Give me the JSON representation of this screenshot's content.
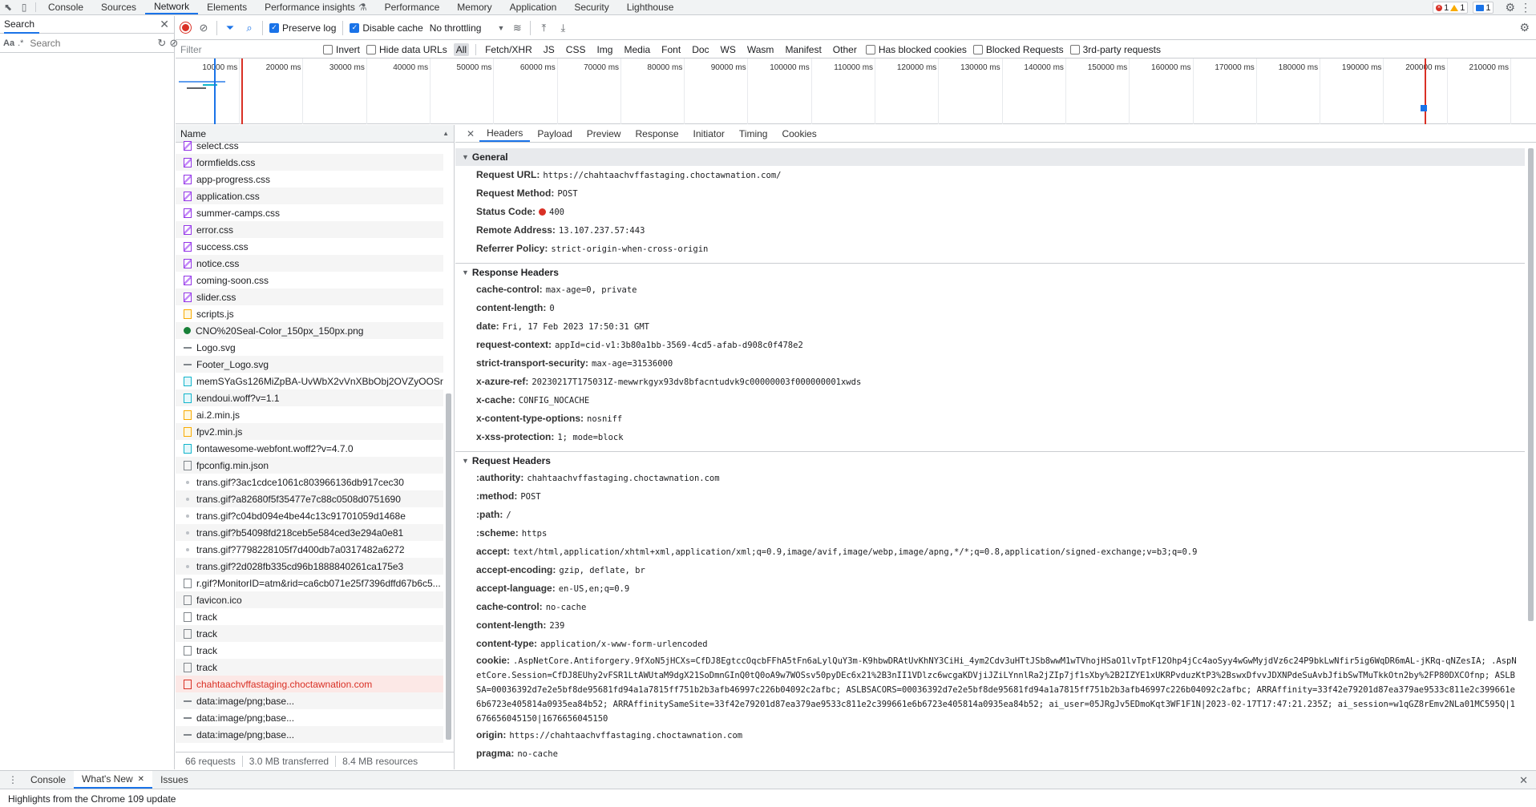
{
  "topbar": {
    "tabs": [
      "Console",
      "Sources",
      "Network",
      "Elements",
      "Performance insights",
      "Performance",
      "Memory",
      "Application",
      "Security",
      "Lighthouse"
    ],
    "active_tab": "Network",
    "errors": "1",
    "warnings": "1",
    "messages": "1"
  },
  "search_pane": {
    "title": "Search",
    "case_label": "Aa",
    "regex_label": ".*",
    "placeholder": "Search"
  },
  "toolbar": {
    "preserve_log": "Preserve log",
    "disable_cache": "Disable cache",
    "throttling": "No throttling"
  },
  "filter": {
    "placeholder": "Filter",
    "invert": "Invert",
    "hide_data_urls": "Hide data URLs",
    "types": [
      "All",
      "Fetch/XHR",
      "JS",
      "CSS",
      "Img",
      "Media",
      "Font",
      "Doc",
      "WS",
      "Wasm",
      "Manifest",
      "Other"
    ],
    "has_blocked_cookies": "Has blocked cookies",
    "blocked_requests": "Blocked Requests",
    "third_party": "3rd-party requests"
  },
  "overview": {
    "ticks": [
      "10000 ms",
      "20000 ms",
      "30000 ms",
      "40000 ms",
      "50000 ms",
      "60000 ms",
      "70000 ms",
      "80000 ms",
      "90000 ms",
      "100000 ms",
      "110000 ms",
      "120000 ms",
      "130000 ms",
      "140000 ms",
      "150000 ms",
      "160000 ms",
      "170000 ms",
      "180000 ms",
      "190000 ms",
      "200000 ms",
      "210000 ms"
    ]
  },
  "request_list": {
    "column": "Name",
    "rows": [
      {
        "name": "select.css",
        "type": "css"
      },
      {
        "name": "formfields.css",
        "type": "css"
      },
      {
        "name": "app-progress.css",
        "type": "css"
      },
      {
        "name": "application.css",
        "type": "css"
      },
      {
        "name": "summer-camps.css",
        "type": "css"
      },
      {
        "name": "error.css",
        "type": "css"
      },
      {
        "name": "success.css",
        "type": "css"
      },
      {
        "name": "notice.css",
        "type": "css"
      },
      {
        "name": "coming-soon.css",
        "type": "css"
      },
      {
        "name": "slider.css",
        "type": "css"
      },
      {
        "name": "scripts.js",
        "type": "js"
      },
      {
        "name": "CNO%20Seal-Color_150px_150px.png",
        "type": "img"
      },
      {
        "name": "Logo.svg",
        "type": "svg"
      },
      {
        "name": "Footer_Logo.svg",
        "type": "svg"
      },
      {
        "name": "memSYaGs126MiZpBA-UvWbX2vVnXBbObj2OVZyOOSr4...",
        "type": "font"
      },
      {
        "name": "kendoui.woff?v=1.1",
        "type": "font"
      },
      {
        "name": "ai.2.min.js",
        "type": "js"
      },
      {
        "name": "fpv2.min.js",
        "type": "js"
      },
      {
        "name": "fontawesome-webfont.woff2?v=4.7.0",
        "type": "font"
      },
      {
        "name": "fpconfig.min.json",
        "type": "doc"
      },
      {
        "name": "trans.gif?3ac1cdce1061c803966136db917cec30",
        "type": "gif"
      },
      {
        "name": "trans.gif?a82680f5f35477e7c88c0508d0751690",
        "type": "gif"
      },
      {
        "name": "trans.gif?c04bd094e4be44c13c91701059d1468e",
        "type": "gif"
      },
      {
        "name": "trans.gif?b54098fd218ceb5e584ced3e294a0e81",
        "type": "gif"
      },
      {
        "name": "trans.gif?7798228105f7d400db7a0317482a6272",
        "type": "gif"
      },
      {
        "name": "trans.gif?2d028fb335cd96b1888840261ca175e3",
        "type": "gif"
      },
      {
        "name": "r.gif?MonitorID=atm&rid=ca6cb071e25f7396dffd67b6c5...",
        "type": "doc"
      },
      {
        "name": "favicon.ico",
        "type": "doc"
      },
      {
        "name": "track",
        "type": "doc"
      },
      {
        "name": "track",
        "type": "doc"
      },
      {
        "name": "track",
        "type": "doc"
      },
      {
        "name": "track",
        "type": "doc"
      },
      {
        "name": "chahtaachvffastaging.choctawnation.com",
        "type": "errdoc",
        "error": true
      },
      {
        "name": "data:image/png;base...",
        "type": "svg"
      },
      {
        "name": "data:image/png;base...",
        "type": "svg"
      },
      {
        "name": "data:image/png;base...",
        "type": "svg"
      }
    ],
    "status": {
      "requests": "66 requests",
      "transferred": "3.0 MB transferred",
      "resources": "8.4 MB resources"
    }
  },
  "details": {
    "tabs": [
      "Headers",
      "Payload",
      "Preview",
      "Response",
      "Initiator",
      "Timing",
      "Cookies"
    ],
    "active_tab": "Headers",
    "general": {
      "title": "General",
      "items": [
        {
          "k": "Request URL:",
          "v": "https://chahtaachvffastaging.choctawnation.com/"
        },
        {
          "k": "Request Method:",
          "v": "POST"
        },
        {
          "k": "Status Code:",
          "v": "400",
          "dot": true
        },
        {
          "k": "Remote Address:",
          "v": "13.107.237.57:443"
        },
        {
          "k": "Referrer Policy:",
          "v": "strict-origin-when-cross-origin"
        }
      ]
    },
    "response_headers": {
      "title": "Response Headers",
      "items": [
        {
          "k": "cache-control:",
          "v": "max-age=0, private"
        },
        {
          "k": "content-length:",
          "v": "0"
        },
        {
          "k": "date:",
          "v": "Fri, 17 Feb 2023 17:50:31 GMT"
        },
        {
          "k": "request-context:",
          "v": "appId=cid-v1:3b80a1bb-3569-4cd5-afab-d908c0f478e2"
        },
        {
          "k": "strict-transport-security:",
          "v": "max-age=31536000"
        },
        {
          "k": "x-azure-ref:",
          "v": "20230217T175031Z-mewwrkgyx93dv8bfacntudvk9c00000003f000000001xwds"
        },
        {
          "k": "x-cache:",
          "v": "CONFIG_NOCACHE"
        },
        {
          "k": "x-content-type-options:",
          "v": "nosniff"
        },
        {
          "k": "x-xss-protection:",
          "v": "1; mode=block"
        }
      ]
    },
    "request_headers": {
      "title": "Request Headers",
      "items": [
        {
          "k": ":authority:",
          "v": "chahtaachvffastaging.choctawnation.com"
        },
        {
          "k": ":method:",
          "v": "POST"
        },
        {
          "k": ":path:",
          "v": "/"
        },
        {
          "k": ":scheme:",
          "v": "https"
        },
        {
          "k": "accept:",
          "v": "text/html,application/xhtml+xml,application/xml;q=0.9,image/avif,image/webp,image/apng,*/*;q=0.8,application/signed-exchange;v=b3;q=0.9"
        },
        {
          "k": "accept-encoding:",
          "v": "gzip, deflate, br"
        },
        {
          "k": "accept-language:",
          "v": "en-US,en;q=0.9"
        },
        {
          "k": "cache-control:",
          "v": "no-cache"
        },
        {
          "k": "content-length:",
          "v": "239"
        },
        {
          "k": "content-type:",
          "v": "application/x-www-form-urlencoded"
        }
      ],
      "cookie_key": "cookie:",
      "cookie_value": ".AspNetCore.Antiforgery.9fXoN5jHCXs=CfDJ8EgtccOqcbFFhA5tFn6aLylQuY3m-K9hbwDRAtUvKhNY3CiHi_4ym2Cdv3uHTtJSb8wwM1wTVhojHSaO1lvTptF12Ohp4jCc4aoSyy4wGwMyjdVz6c24P9bkLwNfir5ig6WqDR6mAL-jKRq-qNZesIA; .AspNetCore.Session=CfDJ8EUhy2vFSR1LtAWUtaM9dgX21SoDmnGInQ0tQ0oA9w7WOSsv50pyDEc6x21%2B3nII1VDlzc6wcgaKDVjiJZiLYnnlRa2jZIp7jf1sXby%2B2IZYE1xUKRPvduzKtP3%2BswxDfvvJDXNPdeSuAvbJfibSwTMuTkkOtn2by%2FP80DXCOfnp; ASLBSA=00036392d7e2e5bf8de95681fd94a1a7815ff751b2b3afb46997c226b04092c2afbc; ASLBSACORS=00036392d7e2e5bf8de95681fd94a1a7815ff751b2b3afb46997c226b04092c2afbc; ARRAffinity=33f42e79201d87ea379ae9533c811e2c399661e6b6723e405814a0935ea84b52; ARRAffinitySameSite=33f42e79201d87ea379ae9533c811e2c399661e6b6723e405814a0935ea84b52; ai_user=05JRgJv5EDmoKqt3WF1F1N|2023-02-17T17:47:21.235Z; ai_session=w1qGZ8rEmv2NLa01MC595Q|1676656045150|1676656045150",
      "tail": [
        {
          "k": "origin:",
          "v": "https://chahtaachvffastaging.choctawnation.com"
        },
        {
          "k": "pragma:",
          "v": "no-cache"
        }
      ]
    }
  },
  "drawer": {
    "tabs": [
      "Console",
      "What's New",
      "Issues"
    ],
    "active_tab": "What's New",
    "body": "Highlights from the Chrome 109 update"
  }
}
